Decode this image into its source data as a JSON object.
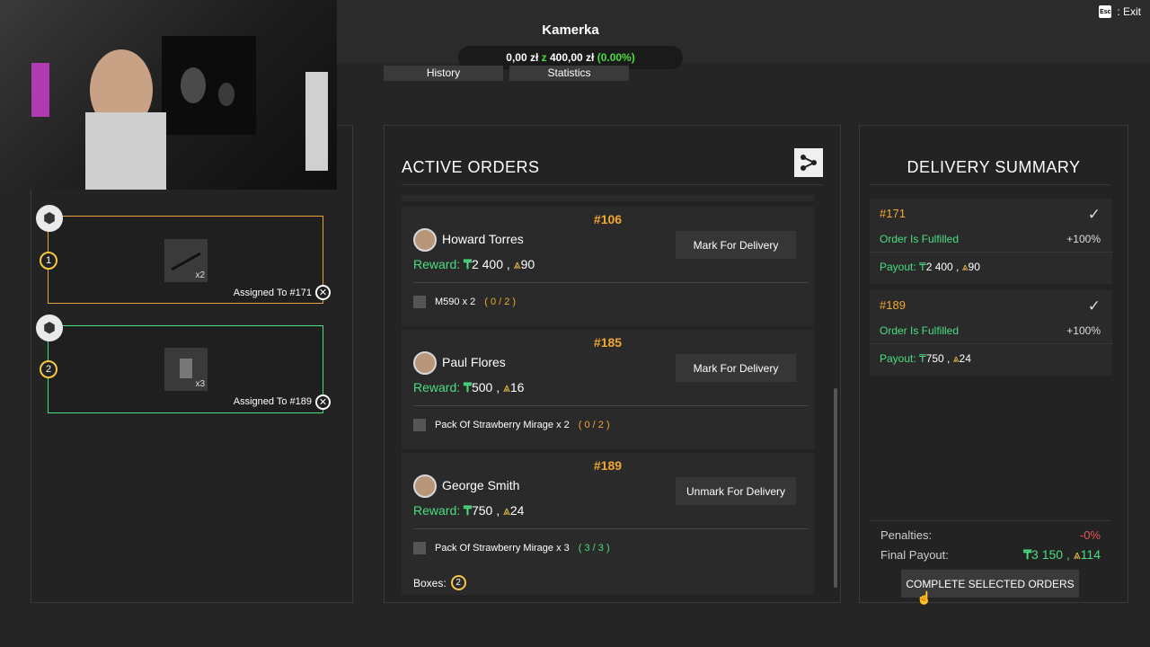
{
  "header": {
    "title": "Kamerka",
    "money_current": "0,00 zł",
    "money_sep": "z",
    "money_target": "400,00 zł",
    "money_pct": "(0.00%)",
    "exit_key": "Esc",
    "exit_label": ": Exit"
  },
  "tabs": [
    {
      "label": "History"
    },
    {
      "label": "Statistics"
    }
  ],
  "left_panel": {
    "boxes": [
      {
        "number": "1",
        "qty": "x2",
        "assigned": "Assigned To #171",
        "border": "#e8a33a"
      },
      {
        "number": "2",
        "qty": "x3",
        "assigned": "Assigned To #189",
        "border": "#4ade80"
      }
    ]
  },
  "active_orders": {
    "title": "ACTIVE ORDERS",
    "reward_label": "Reward:",
    "orders": [
      {
        "id": "#106",
        "customer": "Howard Torres",
        "cash": "2 400",
        "rep": "90",
        "button": "Mark For Delivery",
        "item": "M590 x 2",
        "progress": "( 0 / 2 )"
      },
      {
        "id": "#185",
        "customer": "Paul Flores",
        "cash": "500",
        "rep": "16",
        "button": "Mark For Delivery",
        "item": "Pack Of Strawberry Mirage x 2",
        "progress": "( 0 / 2 )"
      },
      {
        "id": "#189",
        "customer": "George Smith",
        "cash": "750",
        "rep": "24",
        "button": "Unmark For Delivery",
        "item": "Pack Of Strawberry Mirage x 3",
        "progress": "( 3 / 3 )",
        "boxes_label": "Boxes:",
        "boxes_value": "2"
      }
    ]
  },
  "delivery_summary": {
    "title": "DELIVERY SUMMARY",
    "cards": [
      {
        "id": "#171",
        "status": "Order Is Fulfilled",
        "pct": "+100%",
        "payout_label": "Payout:",
        "cash": "2 400",
        "rep": "90"
      },
      {
        "id": "#189",
        "status": "Order Is Fulfilled",
        "pct": "+100%",
        "payout_label": "Payout:",
        "cash": "750",
        "rep": "24"
      }
    ],
    "penalties_label": "Penalties:",
    "penalties_value": "-0%",
    "final_label": "Final Payout:",
    "final_cash": "3 150",
    "final_rep": "114",
    "complete_button": "COMPLETE SELECTED ORDERS"
  },
  "colors": {
    "accent_orange": "#f0a830",
    "accent_green": "#4ade80",
    "penalty_red": "#e25555"
  }
}
